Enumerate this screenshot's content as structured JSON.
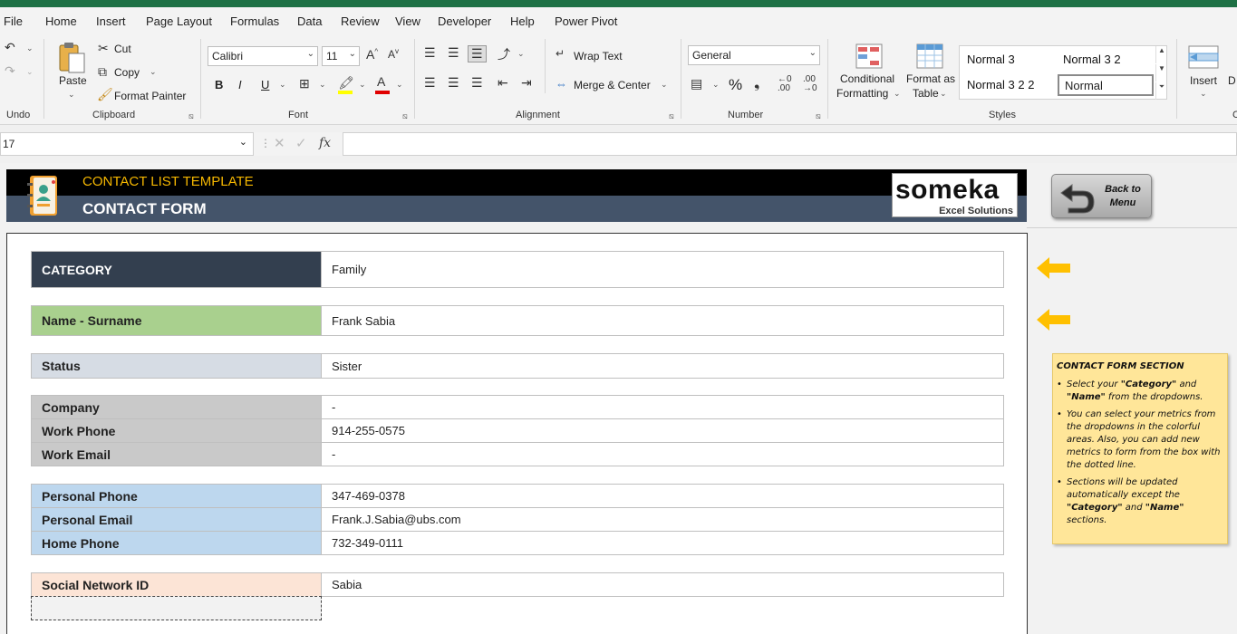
{
  "menu": {
    "tabs": [
      "File",
      "Home",
      "Insert",
      "Page Layout",
      "Formulas",
      "Data",
      "Review",
      "View",
      "Developer",
      "Help",
      "Power Pivot"
    ],
    "active": "Home"
  },
  "ribbon": {
    "undo_label": "Undo",
    "clipboard": {
      "paste": "Paste",
      "cut": "Cut",
      "copy": "Copy",
      "format_painter": "Format Painter",
      "group": "Clipboard"
    },
    "font": {
      "name": "Calibri",
      "size": "11",
      "group": "Font",
      "bold": "B",
      "italic": "I",
      "underline": "U"
    },
    "alignment": {
      "wrap_text": "Wrap Text",
      "merge_center": "Merge & Center",
      "group": "Alignment"
    },
    "number": {
      "format": "General",
      "group": "Number",
      "percent": "%"
    },
    "styles": {
      "conditional": "Conditional",
      "formatting": "Formatting",
      "format_as": "Format as",
      "table": "Table",
      "cells": [
        "Normal 3",
        "Normal 3 2",
        "Normal 3 2 2",
        "Normal"
      ],
      "group": "Styles"
    },
    "cells_group": {
      "insert": "Insert",
      "partial_d": "D",
      "partial_c": "C"
    }
  },
  "formula_bar": {
    "name_box": "17",
    "fx": "fx",
    "value": ""
  },
  "banner": {
    "subtitle": "CONTACT LIST TEMPLATE",
    "title": "CONTACT FORM",
    "brand": "someka",
    "brand_sub": "Excel Solutions"
  },
  "back_button": {
    "line1": "Back to",
    "line2": "Menu"
  },
  "form": {
    "category": {
      "label": "CATEGORY",
      "value": "Family"
    },
    "name": {
      "label": "Name - Surname",
      "value": "Frank Sabia"
    },
    "status": {
      "label": "Status",
      "value": "Sister"
    },
    "company": {
      "label": "Company",
      "value": "-"
    },
    "work_phone": {
      "label": "Work Phone",
      "value": "914-255-0575"
    },
    "work_email": {
      "label": "Work Email",
      "value": "-"
    },
    "personal_phone": {
      "label": "Personal Phone",
      "value": "347-469-0378"
    },
    "personal_email": {
      "label": "Personal Email",
      "value": "Frank.J.Sabia@ubs.com"
    },
    "home_phone": {
      "label": "Home Phone",
      "value": "732-349-0111"
    },
    "social": {
      "label": "Social Network ID",
      "value": "Sabia"
    }
  },
  "colors": {
    "category_bg": "#333f4f",
    "name_bg": "#a9d08e",
    "status_bg": "#d6dce4",
    "company_bg": "#c9c9c9",
    "personal_bg": "#bdd7ee",
    "social_bg": "#fce4d6",
    "arrow": "#ffc000"
  },
  "note": {
    "heading": "CONTACT FORM SECTION",
    "b1_pre": "Select your ",
    "b1_cat": "\"Category\"",
    "b1_mid": " and ",
    "b1_name": "\"Name\"",
    "b1_post": " from the dropdowns.",
    "b2": "You can select your metrics from the dropdowns in the colorful areas. Also, you can add new metrics to form from the box with the dotted line.",
    "b3_pre": "Sections will be updated automatically except the ",
    "b3_cat": "\"Category\"",
    "b3_mid": " and ",
    "b3_name": "\"Name\"",
    "b3_post": " sections."
  }
}
